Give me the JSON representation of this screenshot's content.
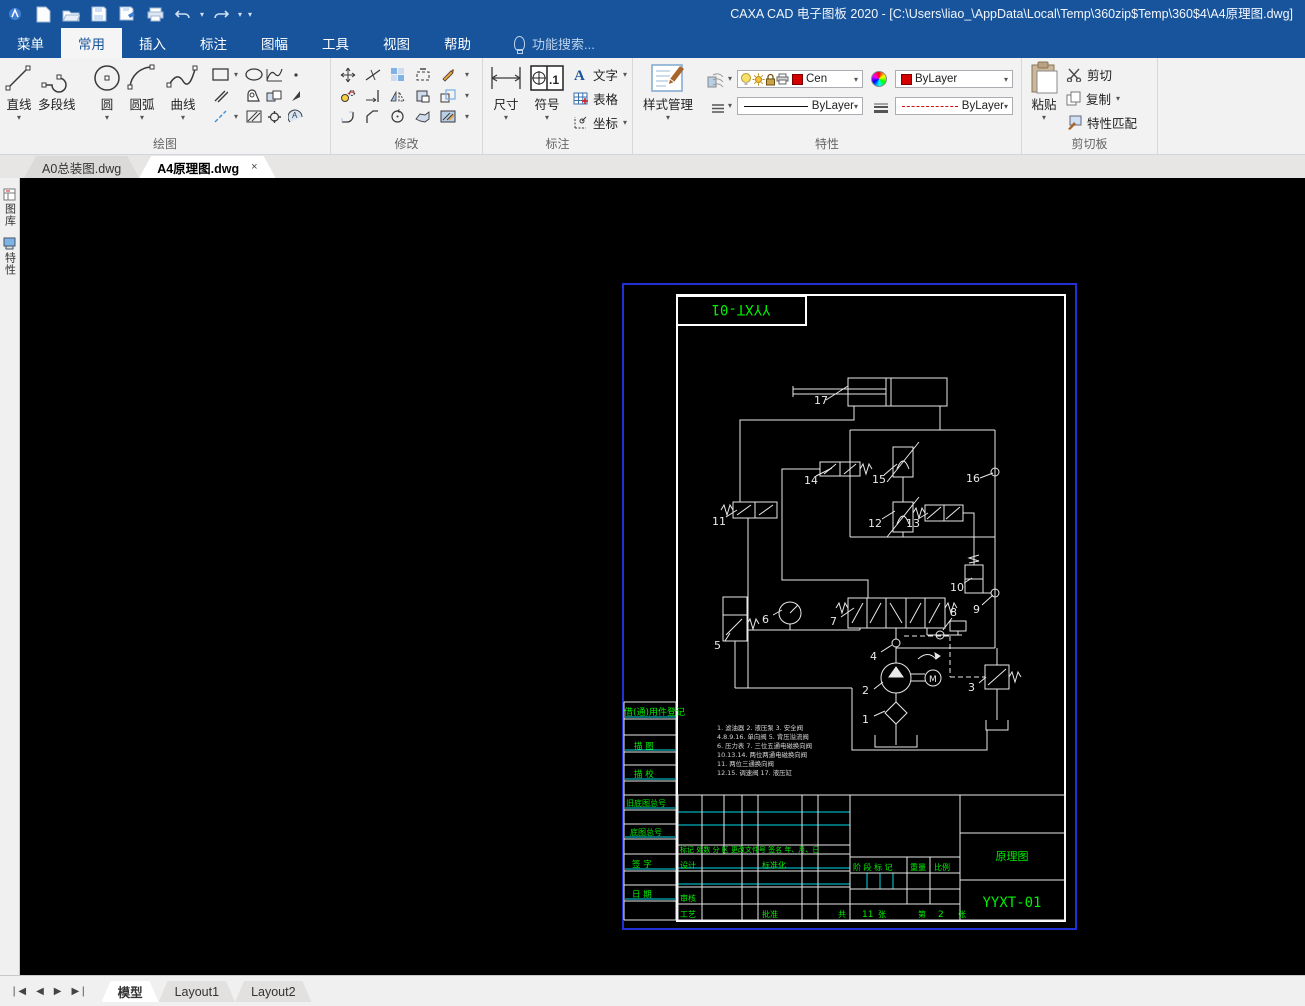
{
  "window": {
    "title": "CAXA CAD 电子图板 2020 - [C:\\Users\\liao_\\AppData\\Local\\Temp\\360zip$Temp\\360$4\\A4原理图.dwg]"
  },
  "menu": {
    "tabs": [
      "菜单",
      "常用",
      "插入",
      "标注",
      "图幅",
      "工具",
      "视图",
      "帮助"
    ],
    "active": "常用",
    "search": "功能搜索..."
  },
  "ribbon": {
    "draw": {
      "label": "绘图",
      "buttons": [
        "直线",
        "多段线",
        "圆",
        "圆弧",
        "曲线"
      ]
    },
    "modify": {
      "label": "修改"
    },
    "annotate": {
      "label": "标注",
      "dim": "尺寸",
      "symbol": "符号",
      "text": "文字",
      "table": "表格",
      "coord": "坐标"
    },
    "properties": {
      "label": "特性",
      "style_manager": "样式管理",
      "layer_value": "Cen",
      "color_value": "ByLayer",
      "linetype_value": "ByLayer",
      "linewidth_value": "ByLayer"
    },
    "clipboard": {
      "label": "剪切板",
      "paste": "粘贴",
      "cut": "剪切",
      "copy": "复制",
      "match": "特性匹配"
    }
  },
  "doc_tabs": {
    "tab1": "A0总装图.dwg",
    "tab2": "A4原理图.dwg",
    "close": "×"
  },
  "side_panel": {
    "library": "图库",
    "properties": "特性"
  },
  "drawing": {
    "sheet_code_top": "YYXT-01",
    "component_labels": [
      "17",
      "14",
      "15",
      "16",
      "11",
      "12",
      "13",
      "10",
      "9",
      "8",
      "7",
      "6",
      "5",
      "4",
      "3",
      "2",
      "1"
    ],
    "motor_letter": "M",
    "notes": [
      "1. 滤油器   2. 液压泵   3. 安全阀",
      "4.8.9.16. 单向阀   5. 背压溢流阀",
      "6. 压力表  7. 三位五通电磁换向阀",
      "10.13.14. 两位两通电磁换向阀",
      "11. 两位三通换向阀",
      "12.15. 调速阀     17. 液压缸"
    ],
    "margin": {
      "borrow": "借(通)用件登记",
      "trace": "描  图",
      "trace_check": "描  校"
    },
    "title_block": {
      "old_base_label": "旧底图总号",
      "base_label": "底图总号",
      "sign_label": "签  字",
      "date_label": "日  期",
      "header_row": "标记 处数 分 区 更改文件号 签名 年、月、日",
      "design": "设计",
      "standard": "标准化",
      "audit": "审核",
      "craft": "工艺",
      "approve": "批准",
      "total": "共",
      "stage": "阶 段 标 记",
      "weight": "重量",
      "scale": "比例",
      "sheets_num": "11",
      "sheets_unit": "张",
      "no_label": "第",
      "sheet_index": "2",
      "sheet_unit2": "张",
      "title": "原理图",
      "code": "YYXT-01"
    }
  },
  "bottom_bar": {
    "model": "模型",
    "layout1": "Layout1",
    "layout2": "Layout2"
  }
}
